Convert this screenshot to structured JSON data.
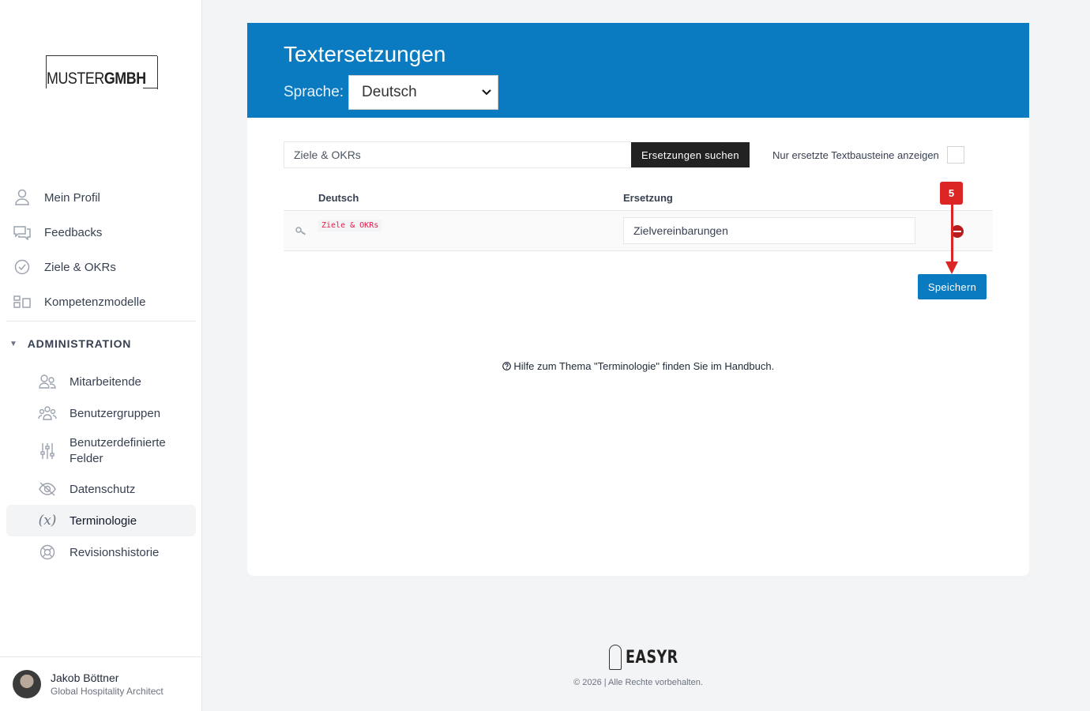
{
  "brand": {
    "logo_regular": "MUSTER",
    "logo_bold": "GMBH"
  },
  "sidebar": {
    "items": [
      {
        "label": "Mein Profil",
        "icon": "user-icon"
      },
      {
        "label": "Feedbacks",
        "icon": "chat-icon"
      },
      {
        "label": "Ziele & OKRs",
        "icon": "check-circle-icon"
      },
      {
        "label": "Kompetenzmodelle",
        "icon": "blocks-icon"
      }
    ],
    "admin_heading": "ADMINISTRATION",
    "admin_items": [
      {
        "label": "Mitarbeitende",
        "icon": "users-icon"
      },
      {
        "label": "Benutzergruppen",
        "icon": "group-icon"
      },
      {
        "label": "Benutzerdefinierte Felder",
        "icon": "sliders-icon"
      },
      {
        "label": "Datenschutz",
        "icon": "eye-off-icon"
      },
      {
        "label": "Terminologie",
        "icon": "variable-icon",
        "active": true
      },
      {
        "label": "Revisionshistorie",
        "icon": "lifebuoy-icon"
      }
    ]
  },
  "user": {
    "name": "Jakob Böttner",
    "role": "Global Hospitality Architect"
  },
  "page": {
    "title": "Textersetzungen",
    "language_label": "Sprache:",
    "language_value": "Deutsch",
    "search_value": "Ziele & OKRs",
    "search_button": "Ersetzungen suchen",
    "only_replaced_label": "Nur ersetzte Textbausteine anzeigen",
    "table": {
      "columns": [
        "Deutsch",
        "Ersetzung"
      ],
      "rows": [
        {
          "original": "Ziele & OKRs",
          "replacement": "Zielvereinbarungen"
        }
      ]
    },
    "save_button": "Speichern",
    "help_text": "Hilfe zum Thema \"Terminologie\" finden Sie im Handbuch.",
    "annotation_badge": "5"
  },
  "footer": {
    "brand": "EASYR",
    "copyright": "© 2026 | Alle Rechte vorbehalten."
  },
  "colors": {
    "primary": "#0a7bc1",
    "annotation": "#dc2626",
    "code": "#e11d48"
  }
}
